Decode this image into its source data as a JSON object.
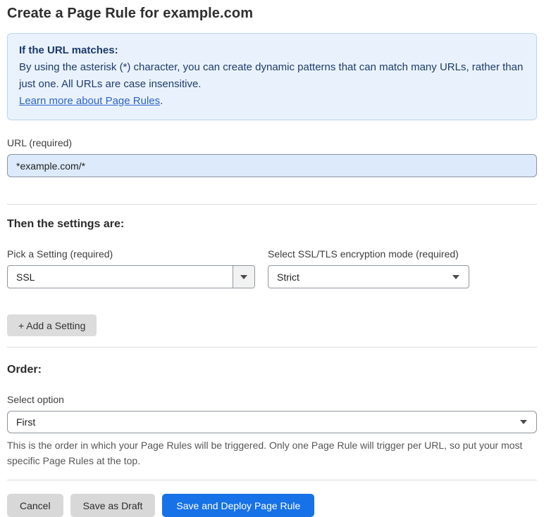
{
  "page": {
    "title": "Create a Page Rule for example.com"
  },
  "info_box": {
    "heading": "If the URL matches:",
    "body": "By using the asterisk (*) character, you can create dynamic patterns that can match many URLs, rather than just one. All URLs are case insensitive.",
    "link_label": "Learn more about Page Rules",
    "link_suffix": "."
  },
  "url_field": {
    "label": "URL (required)",
    "value": "*example.com/*"
  },
  "settings_section": {
    "heading": "Then the settings are:",
    "setting_picker": {
      "label": "Pick a Setting (required)",
      "value": "SSL"
    },
    "ssl_mode": {
      "label": "Select SSL/TLS encryption mode (required)",
      "value": "Strict"
    },
    "add_setting_label": "+ Add a Setting"
  },
  "order_section": {
    "heading": "Order:",
    "select_label": "Select option",
    "value": "First",
    "help_text": "This is the order in which your Page Rules will be triggered. Only one Page Rule will trigger per URL, so put your most specific Page Rules at the top."
  },
  "actions": {
    "cancel": "Cancel",
    "save_draft": "Save as Draft",
    "save_deploy": "Save and Deploy Page Rule"
  },
  "colors": {
    "accent_blue": "#1672e6",
    "info_bg": "#e9f2fc",
    "info_border": "#b9d6f0",
    "info_text": "#1e3c6e",
    "link_blue": "#2c64c8",
    "input_bg": "#dceafc",
    "button_gray": "#d8d8d8"
  }
}
